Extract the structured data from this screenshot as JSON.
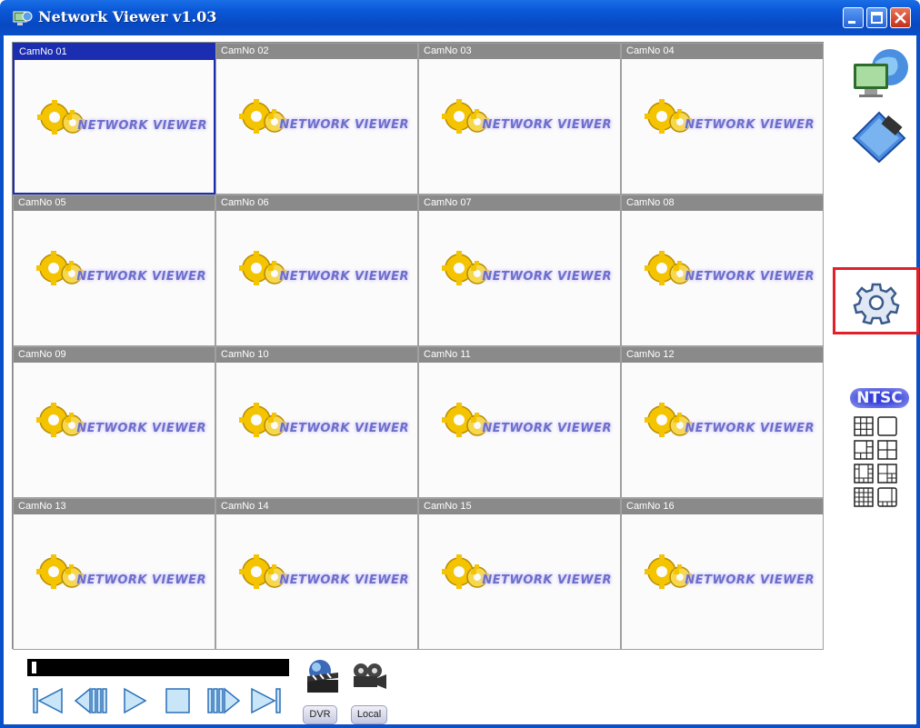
{
  "window": {
    "title": "Network Viewer v1.03",
    "accent": "#0a58d8",
    "selected_color": "#1b2db0"
  },
  "cameras": [
    {
      "label": "CamNo 01",
      "logo": "NETWORK VIEWER",
      "selected": true
    },
    {
      "label": "CamNo 02",
      "logo": "NETWORK VIEWER"
    },
    {
      "label": "CamNo 03",
      "logo": "NETWORK VIEWER"
    },
    {
      "label": "CamNo 04",
      "logo": "NETWORK VIEWER"
    },
    {
      "label": "CamNo 05",
      "logo": "NETWORK VIEWER"
    },
    {
      "label": "CamNo 06",
      "logo": "NETWORK VIEWER"
    },
    {
      "label": "CamNo 07",
      "logo": "NETWORK VIEWER"
    },
    {
      "label": "CamNo 08",
      "logo": "NETWORK VIEWER"
    },
    {
      "label": "CamNo 09",
      "logo": "NETWORK VIEWER"
    },
    {
      "label": "CamNo 10",
      "logo": "NETWORK VIEWER"
    },
    {
      "label": "CamNo 11",
      "logo": "NETWORK VIEWER"
    },
    {
      "label": "CamNo 12",
      "logo": "NETWORK VIEWER"
    },
    {
      "label": "CamNo 13",
      "logo": "NETWORK VIEWER"
    },
    {
      "label": "CamNo 14",
      "logo": "NETWORK VIEWER"
    },
    {
      "label": "CamNo 15",
      "logo": "NETWORK VIEWER"
    },
    {
      "label": "CamNo 16",
      "logo": "NETWORK VIEWER"
    }
  ],
  "sidebar": {
    "icons": [
      "network-monitor-icon",
      "video-file-icon",
      "settings-gear-icon"
    ],
    "highlighted": "settings-gear-icon",
    "video_standard": "NTSC",
    "layouts": [
      "layout-9-icon",
      "layout-1-icon",
      "layout-6-icon",
      "layout-4-icon",
      "layout-8-icon",
      "layout-7-icon",
      "layout-16-icon",
      "layout-10-icon"
    ]
  },
  "playback": {
    "progress": 0.0,
    "controls": [
      "skip-start-icon",
      "step-back-icon",
      "play-icon",
      "stop-icon",
      "step-forward-icon",
      "skip-end-icon"
    ],
    "dvr_label": "DVR",
    "local_label": "Local"
  }
}
